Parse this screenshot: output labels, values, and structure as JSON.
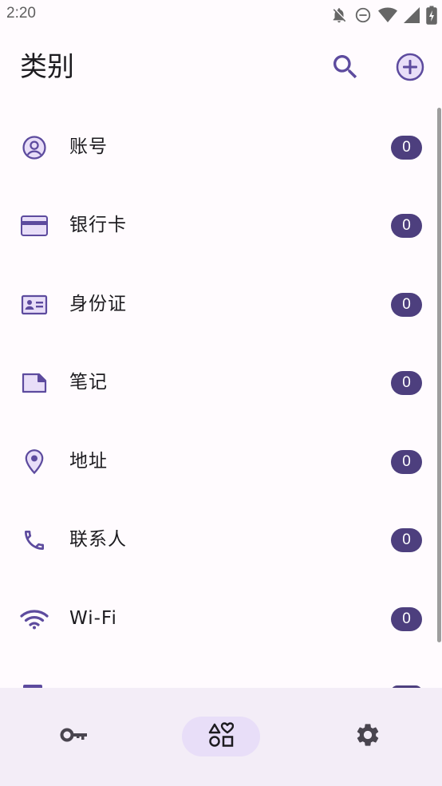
{
  "status_bar": {
    "time": "2:20",
    "icons": [
      "notifications-off-icon",
      "do-not-disturb-icon",
      "wifi-signal-icon",
      "cell-signal-icon",
      "battery-charging-icon"
    ]
  },
  "header": {
    "title": "类别",
    "actions": [
      "search-icon",
      "add-circle-icon"
    ]
  },
  "categories": [
    {
      "label": "账号",
      "count": "0",
      "icon": "account-circle-icon"
    },
    {
      "label": "银行卡",
      "count": "0",
      "icon": "credit-card-icon"
    },
    {
      "label": "身份证",
      "count": "0",
      "icon": "id-card-icon"
    },
    {
      "label": "笔记",
      "count": "0",
      "icon": "note-icon"
    },
    {
      "label": "地址",
      "count": "0",
      "icon": "location-pin-icon"
    },
    {
      "label": "联系人",
      "count": "0",
      "icon": "phone-icon"
    },
    {
      "label": "Wi-Fi",
      "count": "0",
      "icon": "wifi-icon"
    }
  ],
  "bottom_nav": {
    "items": [
      "key-icon",
      "categories-icon",
      "settings-gear-icon"
    ],
    "selected": "categories-icon"
  },
  "colors": {
    "accent": "#6750a4",
    "badge": "#4d3f7e",
    "nav_background": "#f3edf7",
    "nav_selected": "#e8def8",
    "background": "#fffbfe"
  }
}
